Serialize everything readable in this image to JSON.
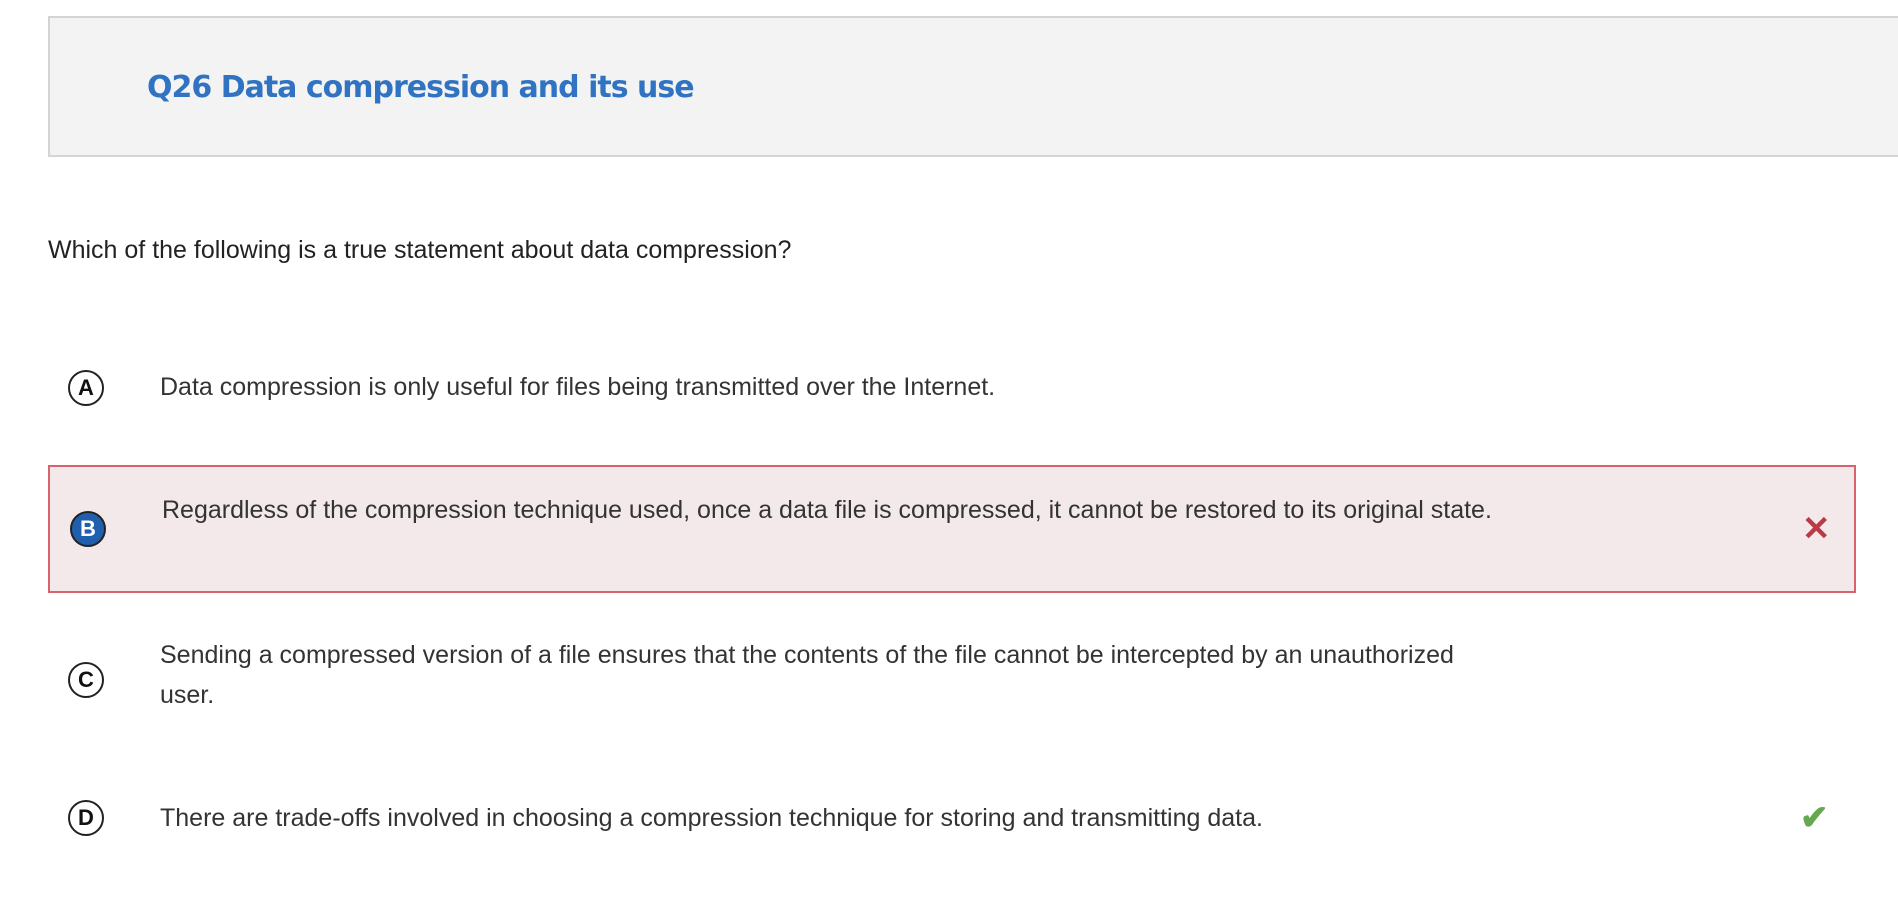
{
  "header": {
    "title": "Q26 Data compression and its use"
  },
  "question": "Which of the following is a true statement about data compression?",
  "options": [
    {
      "letter": "A",
      "text": "Data compression is only useful for files being transmitted over the Internet."
    },
    {
      "letter": "B",
      "text": "Regardless of the compression technique used, once a data file is compressed, it cannot be restored to its original state.",
      "status": "selected-incorrect"
    },
    {
      "letter": "C",
      "text": "Sending a compressed version of a file ensures that the contents of the file cannot be intercepted by an unauthorized user."
    },
    {
      "letter": "D",
      "text": "There are trade-offs involved in choosing a compression technique for storing and transmitting data.",
      "status": "correct"
    }
  ],
  "colors": {
    "title": "#2f73c2",
    "incorrect": "#b83c48",
    "correct": "#66a84f",
    "selected": "#1f5fae"
  },
  "icons": {
    "incorrect": "x-icon",
    "correct": "check-icon"
  }
}
